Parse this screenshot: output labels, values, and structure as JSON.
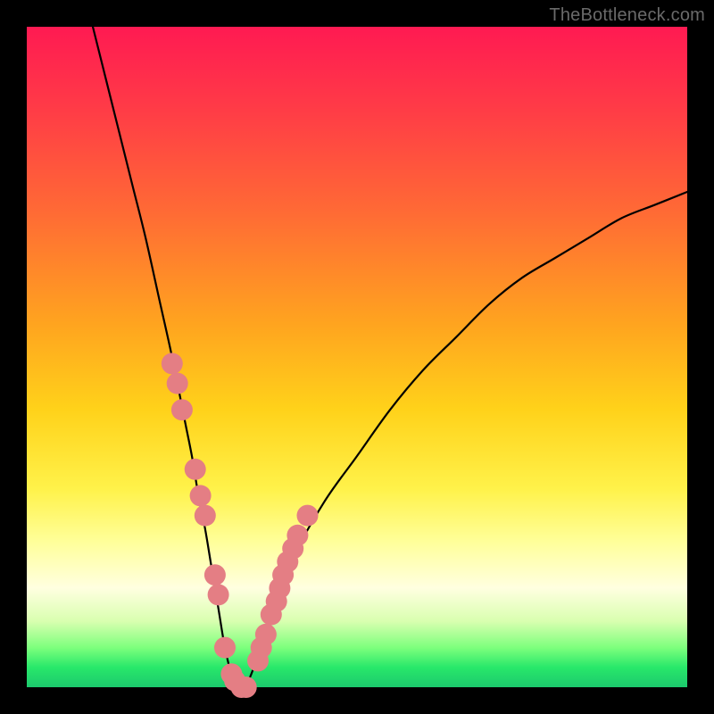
{
  "watermark": "TheBottleneck.com",
  "chart_data": {
    "type": "line",
    "title": "",
    "xlabel": "",
    "ylabel": "",
    "x_range": [
      0,
      100
    ],
    "y_range": [
      0,
      100
    ],
    "curve": {
      "name": "bottleneck-curve",
      "x": [
        10,
        12,
        14,
        16,
        18,
        20,
        22,
        24,
        25,
        26,
        27,
        28,
        29,
        30,
        31,
        32,
        33,
        34,
        35,
        37,
        40,
        45,
        50,
        55,
        60,
        65,
        70,
        75,
        80,
        85,
        90,
        95,
        100
      ],
      "y": [
        100,
        92,
        84,
        76,
        68,
        59,
        50,
        40,
        35,
        29,
        24,
        18,
        12,
        6,
        2,
        0,
        0,
        2,
        5,
        11,
        19,
        28,
        35,
        42,
        48,
        53,
        58,
        62,
        65,
        68,
        71,
        73,
        75
      ]
    },
    "highlight_points": {
      "name": "highlight-dots",
      "color": "#e47e84",
      "x": [
        22.0,
        22.8,
        23.5,
        25.5,
        26.3,
        27.0,
        28.5,
        29.0,
        30.0,
        31.0,
        31.5,
        32.5,
        33.2,
        35.0,
        35.5,
        36.2,
        37.0,
        37.8,
        38.3,
        38.8,
        39.5,
        40.3,
        41.0,
        42.5
      ],
      "y": [
        49,
        46,
        42,
        33,
        29,
        26,
        17,
        14,
        6,
        2,
        1,
        0,
        0,
        4,
        6,
        8,
        11,
        13,
        15,
        17,
        19,
        21,
        23,
        26
      ]
    },
    "background_gradient": {
      "top": "#ff1a52",
      "mid": "#ffd21a",
      "bottom": "#1cc96d"
    }
  }
}
